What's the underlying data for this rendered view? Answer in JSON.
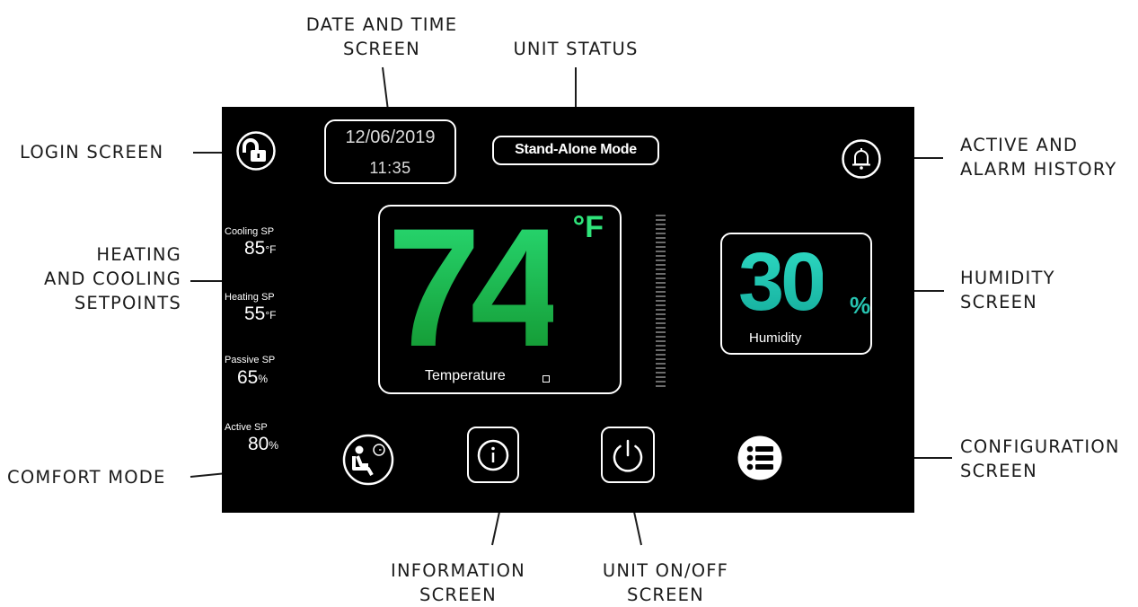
{
  "callouts": {
    "date_time": [
      "DATE AND TIME",
      "SCREEN"
    ],
    "unit_status": "UNIT STATUS",
    "login": "LOGIN SCREEN",
    "alarm": [
      "ACTIVE AND",
      "ALARM HISTORY"
    ],
    "setpoints": [
      "HEATING",
      "AND COOLING",
      "SETPOINTS"
    ],
    "humidity": [
      "HUMIDITY",
      "SCREEN"
    ],
    "comfort": "COMFORT MODE",
    "configuration": [
      "CONFIGURATION",
      "SCREEN"
    ],
    "information": [
      "INFORMATION",
      "SCREEN"
    ],
    "on_off": [
      "UNIT ON/OFF",
      "SCREEN"
    ]
  },
  "screen": {
    "date": "12/06/2019",
    "time": "11:35",
    "status": "Stand-Alone Mode",
    "temperature": {
      "value": "74",
      "unit": "°F",
      "label": "Temperature"
    },
    "humidity": {
      "value": "30",
      "unit": "%",
      "label": "Humidity"
    },
    "setpoints": [
      {
        "label": "Cooling SP",
        "value": "85",
        "unit": "°F"
      },
      {
        "label": "Heating SP",
        "value": "55",
        "unit": "°F"
      },
      {
        "label": "Passive SP",
        "value": "65",
        "unit": "%"
      },
      {
        "label": "Active SP",
        "value": "80",
        "unit": "%"
      }
    ],
    "icons": [
      "unlock-icon",
      "bell-icon",
      "comfort-seat-icon",
      "info-icon",
      "power-icon",
      "menu-list-icon"
    ]
  }
}
